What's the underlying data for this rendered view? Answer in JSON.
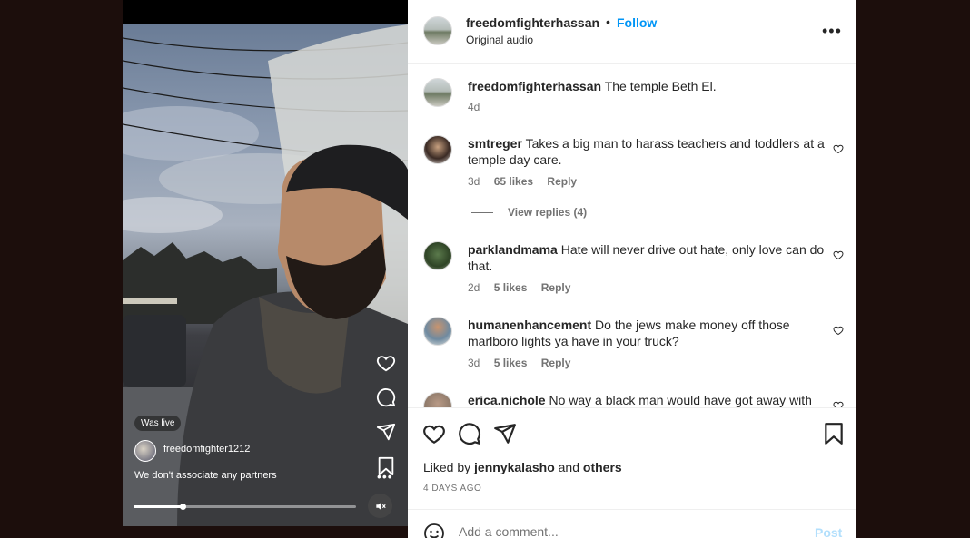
{
  "video": {
    "status_badge": "Was live",
    "username": "freedomfighter1212",
    "caption": "We don't associate any partners",
    "more_label": "•••",
    "progress": 0.22
  },
  "header": {
    "username": "freedomfighterhassan",
    "separator": "•",
    "follow_label": "Follow",
    "audio": "Original audio",
    "more_label": "•••"
  },
  "caption": {
    "username": "freedomfighterhassan",
    "text": "The temple Beth El.",
    "age": "4d"
  },
  "comments": [
    {
      "username": "smtreger",
      "text": "Takes a big man to harass teachers and toddlers at a temple day care.",
      "age": "3d",
      "likes": "65 likes",
      "reply": "Reply",
      "view_replies": "View replies (4)"
    },
    {
      "username": "parklandmama",
      "text": "Hate will never drive out hate, only love can do that.",
      "age": "2d",
      "likes": "5 likes",
      "reply": "Reply"
    },
    {
      "username": "humanenhancement",
      "text": "Do the jews make money off those marlboro lights ya have in your truck?",
      "age": "3d",
      "likes": "5 likes",
      "reply": "Reply"
    },
    {
      "username": "erica.nichole",
      "text": "No way a black man would have got away with"
    }
  ],
  "likes_line": {
    "prefix": "Liked by",
    "user": "jennykalasho",
    "conj": "and",
    "others": "others"
  },
  "post_date": "4 DAYS AGO",
  "add_comment": {
    "placeholder": "Add a comment...",
    "post_label": "Post"
  },
  "colors": {
    "accent": "#0095f6",
    "post_disabled": "#b2dffc",
    "text": "#262626",
    "secondary": "#737373"
  }
}
